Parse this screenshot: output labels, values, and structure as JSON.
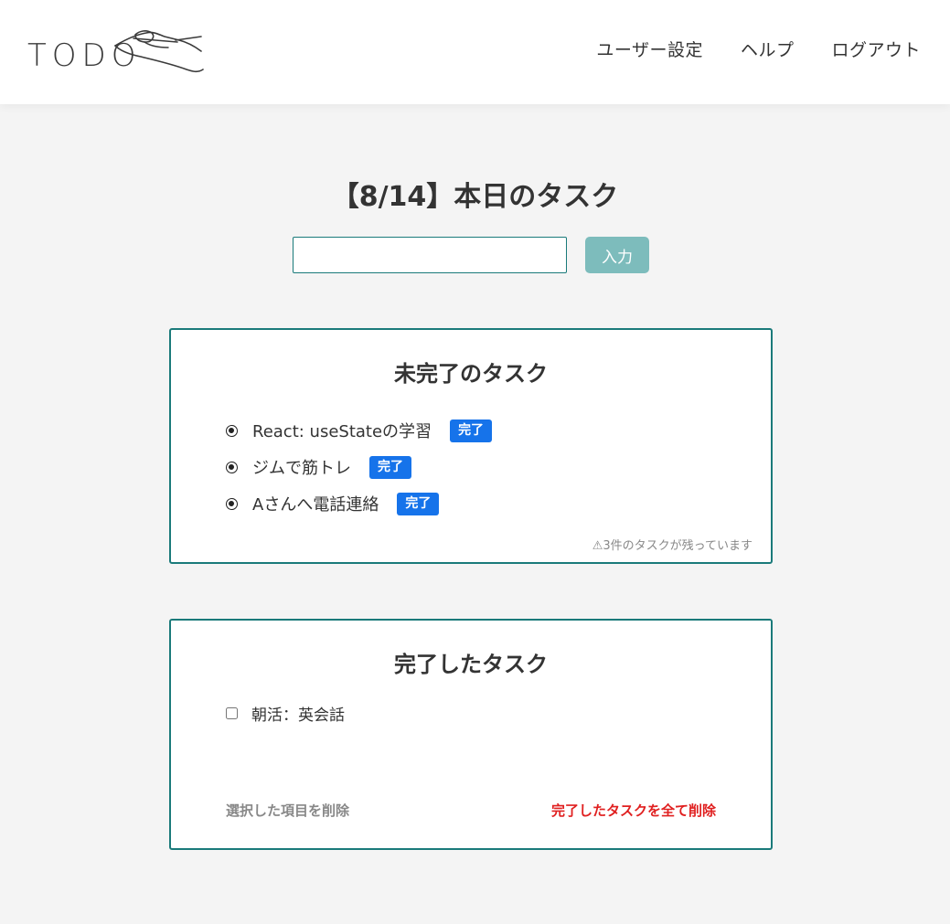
{
  "header": {
    "logo_text": "TODO",
    "nav": [
      {
        "label": "ユーザー設定"
      },
      {
        "label": "ヘルプ"
      },
      {
        "label": "ログアウト"
      }
    ]
  },
  "main": {
    "title": "【8/14】本日のタスク",
    "input": {
      "value": "",
      "placeholder": ""
    },
    "add_button_label": "入力"
  },
  "incomplete": {
    "title": "未完了のタスク",
    "tasks": [
      {
        "text": "React: useStateの学習",
        "button": "完了"
      },
      {
        "text": "ジムで筋トレ",
        "button": "完了"
      },
      {
        "text": "Aさんへ電話連絡",
        "button": "完了"
      }
    ],
    "remaining_note": "⚠3件のタスクが残っています"
  },
  "complete": {
    "title": "完了したタスク",
    "tasks": [
      {
        "text": "朝活：英会話",
        "checked": false
      }
    ],
    "delete_selected_label": "選択した項目を削除",
    "delete_all_label": "完了したタスクを全て削除"
  },
  "colors": {
    "accent": "#1a7a7a",
    "done_button": "#1673ea",
    "add_button": "#7dbcbc",
    "danger": "#e02020",
    "background": "#f4f4f4"
  }
}
